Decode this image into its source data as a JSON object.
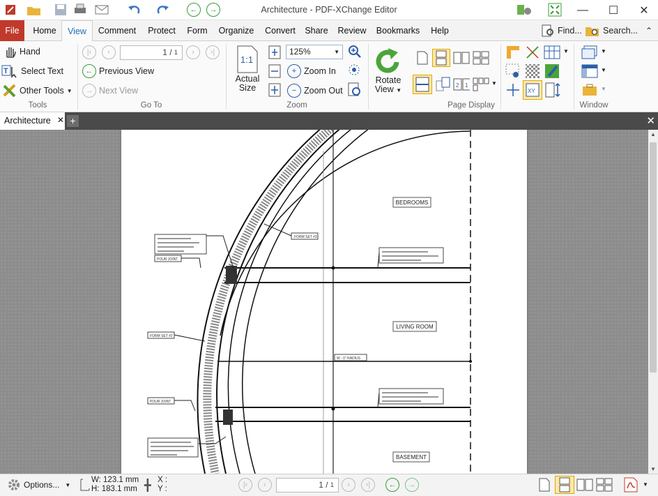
{
  "window": {
    "title": "Architecture - PDF-XChange Editor"
  },
  "menu": {
    "items": [
      "File",
      "Home",
      "View",
      "Comment",
      "Protect",
      "Form",
      "Organize",
      "Convert",
      "Share",
      "Review",
      "Bookmarks",
      "Help"
    ],
    "active": "View",
    "find_label": "Find...",
    "search_label": "Search..."
  },
  "ribbon": {
    "tools": {
      "hand": "Hand",
      "select_text": "Select Text",
      "other_tools": "Other Tools",
      "label": "Tools"
    },
    "goto": {
      "page_value": "1",
      "page_total": "1",
      "previous_view": "Previous View",
      "next_view": "Next View",
      "label": "Go To"
    },
    "zoom": {
      "actual_size_line1": "Actual",
      "actual_size_line2": "Size",
      "zoom_value": "125%",
      "zoom_in": "Zoom In",
      "zoom_out": "Zoom Out",
      "label": "Zoom"
    },
    "page_display": {
      "rotate_line1": "Rotate",
      "rotate_line2": "View",
      "label": "Page Display"
    },
    "window": {
      "label": "Window"
    }
  },
  "tabs": {
    "document": "Architecture"
  },
  "drawing": {
    "rooms": [
      "BEDROOMS",
      "LIVING ROOM",
      "BASEMENT"
    ],
    "notes": [
      "FORM SET #3",
      "FORM SET #2",
      "POUR JOINT",
      "POUR JOINT",
      "W - 0\" RADIUS"
    ]
  },
  "statusbar": {
    "options": "Options...",
    "width": "W: 123.1 mm",
    "height": "H: 183.1 mm",
    "x": "X :",
    "y": "Y :",
    "page_value": "1",
    "page_total": "1"
  },
  "colors": {
    "file_menu": "#c0392b",
    "accent": "#1d6fb8",
    "tabbar": "#4a4a4a",
    "workspace": "#8d8d8d"
  }
}
